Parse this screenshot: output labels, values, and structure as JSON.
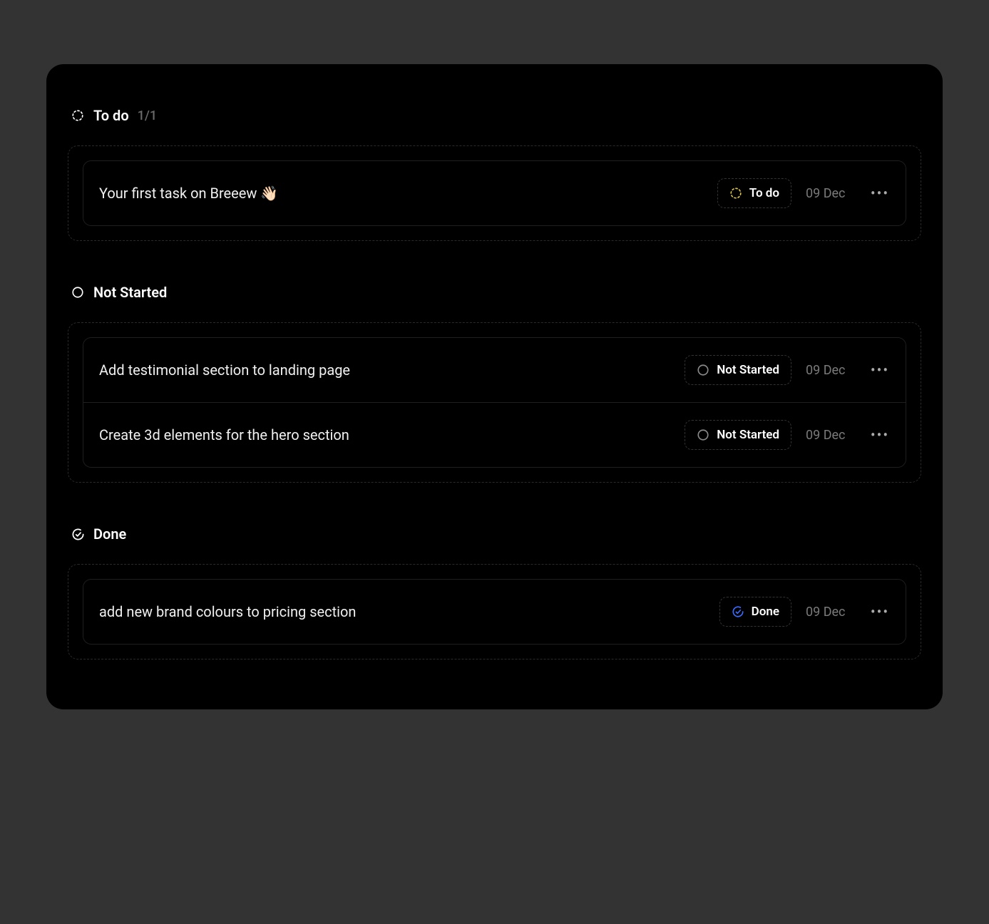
{
  "sections": [
    {
      "id": "todo",
      "title": "To do",
      "count": "1/1",
      "icon": "dashed-circle",
      "iconColor": "#ffffff",
      "tasks": [
        {
          "title": "Your first task on Breeew 👋🏻",
          "status": {
            "label": "To do",
            "icon": "dashed-circle",
            "color": "#d9c24a"
          },
          "date": "09 Dec"
        }
      ]
    },
    {
      "id": "not-started",
      "title": "Not Started",
      "count": "",
      "icon": "empty-circle",
      "iconColor": "#ffffff",
      "tasks": [
        {
          "title": "Add testimonial section to landing page",
          "status": {
            "label": "Not Started",
            "icon": "empty-circle",
            "color": "#8a8a8a"
          },
          "date": "09 Dec"
        },
        {
          "title": "Create 3d elements for the hero section",
          "status": {
            "label": "Not Started",
            "icon": "empty-circle",
            "color": "#8a8a8a"
          },
          "date": "09 Dec"
        }
      ]
    },
    {
      "id": "done",
      "title": "Done",
      "count": "",
      "icon": "check-circle",
      "iconColor": "#ffffff",
      "tasks": [
        {
          "title": "add new brand colours to pricing section",
          "status": {
            "label": "Done",
            "icon": "check-circle",
            "color": "#3b6cff"
          },
          "date": "09 Dec"
        }
      ]
    }
  ]
}
